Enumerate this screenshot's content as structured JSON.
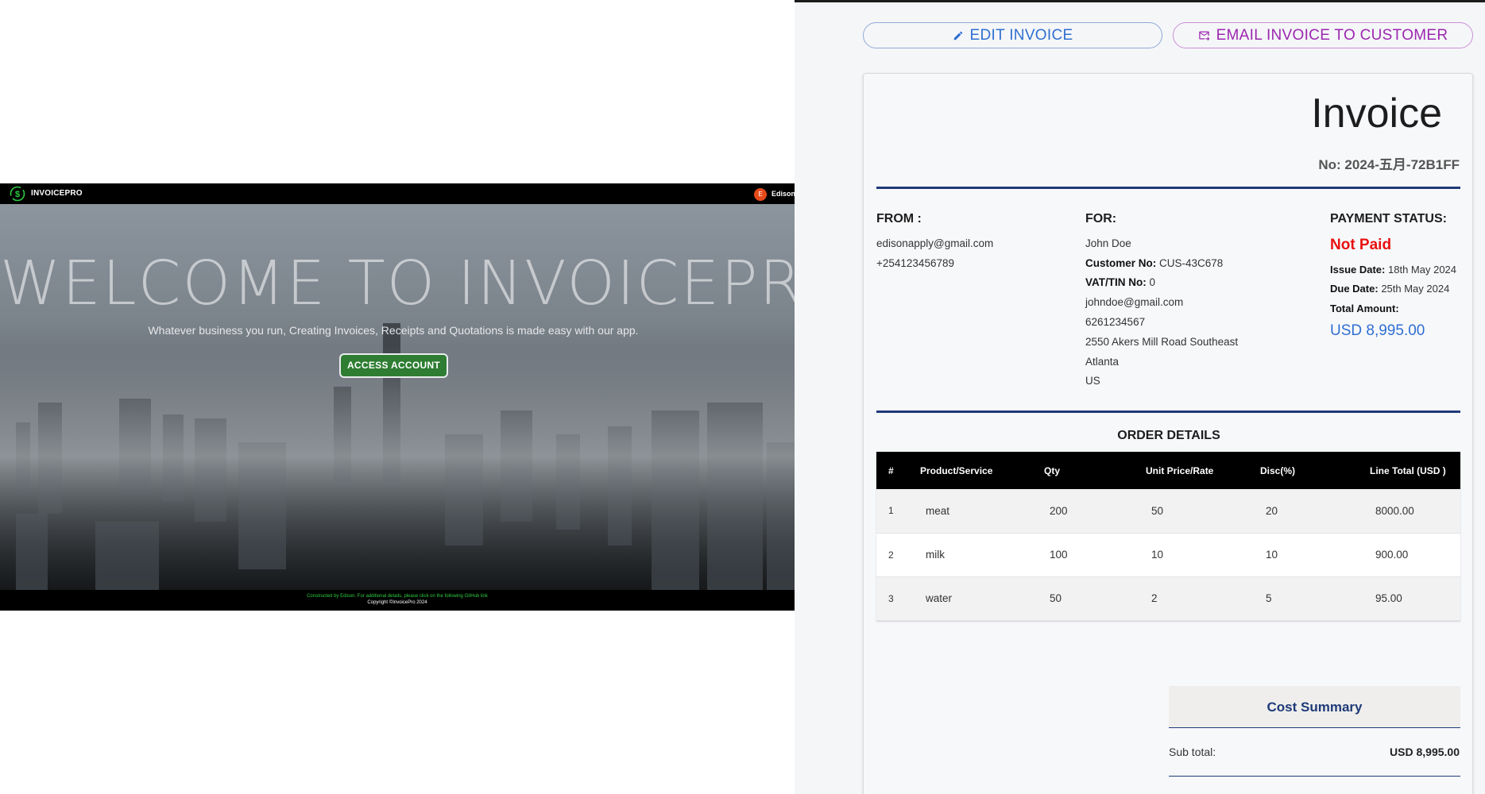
{
  "landing": {
    "brand": "INVOICEPRO",
    "user": {
      "initial": "E",
      "name": "Edisona"
    },
    "hero": {
      "title": "WELCOME TO INVOICEPRO",
      "subtitle": "Whatever business you run, Creating Invoices, Receipts and Quotations is made easy with our app.",
      "cta_label": "ACCESS ACCOUNT"
    },
    "footer": {
      "credit": "Constructed by Edison. For additional details, please click on the following GitHub link",
      "copyright": "Copyright ©InvoicePro 2024"
    },
    "colors": {
      "nav_bg": "#000000",
      "cta_bg": "#2e7d32",
      "footer_credit": "#2ecc40",
      "avatar_bg": "#e64a19"
    }
  },
  "actions": {
    "edit_label": "EDIT INVOICE",
    "email_label": "EMAIL INVOICE TO CUSTOMER",
    "edit_icon": "pencil-icon",
    "email_icon": "email-send-icon"
  },
  "invoice": {
    "heading": "Invoice",
    "number": "No: 2024-五月-72B1FF",
    "from": {
      "heading": "FROM :",
      "email": "edisonapply@gmail.com",
      "phone": "+254123456789"
    },
    "for": {
      "heading": "FOR:",
      "name": "John Doe",
      "customer_no_label": "Customer No:",
      "customer_no": "CUS-43C678",
      "vat_label": "VAT/TIN No:",
      "vat": "0",
      "email": "johndoe@gmail.com",
      "phone": "6261234567",
      "street": "2550 Akers Mill Road Southeast",
      "city": "Atlanta",
      "country": "US"
    },
    "payment": {
      "heading": "PAYMENT STATUS:",
      "status": "Not Paid",
      "issue_label": "Issue Date:",
      "issue_date": "18th May 2024",
      "due_label": "Due Date:",
      "due_date": "25th May 2024",
      "total_label": "Total Amount:",
      "total": "USD 8,995.00",
      "status_color": "#e81010",
      "amount_color": "#2f6fd1"
    },
    "order": {
      "heading": "ORDER DETAILS",
      "columns": [
        "#",
        "Product/Service",
        "Qty",
        "Unit Price/Rate",
        "Disc(%)",
        "Line Total (USD )"
      ],
      "rows": [
        [
          "1",
          "meat",
          "200",
          "50",
          "20",
          "8000.00"
        ],
        [
          "2",
          "milk",
          "100",
          "10",
          "10",
          "900.00"
        ],
        [
          "3",
          "water",
          "50",
          "2",
          "5",
          "95.00"
        ]
      ]
    },
    "summary": {
      "heading": "Cost Summary",
      "subtotal_label": "Sub total:",
      "subtotal": "USD 8,995.00"
    },
    "colors": {
      "divider": "#1e3a78",
      "table_header_bg": "#000000"
    }
  }
}
